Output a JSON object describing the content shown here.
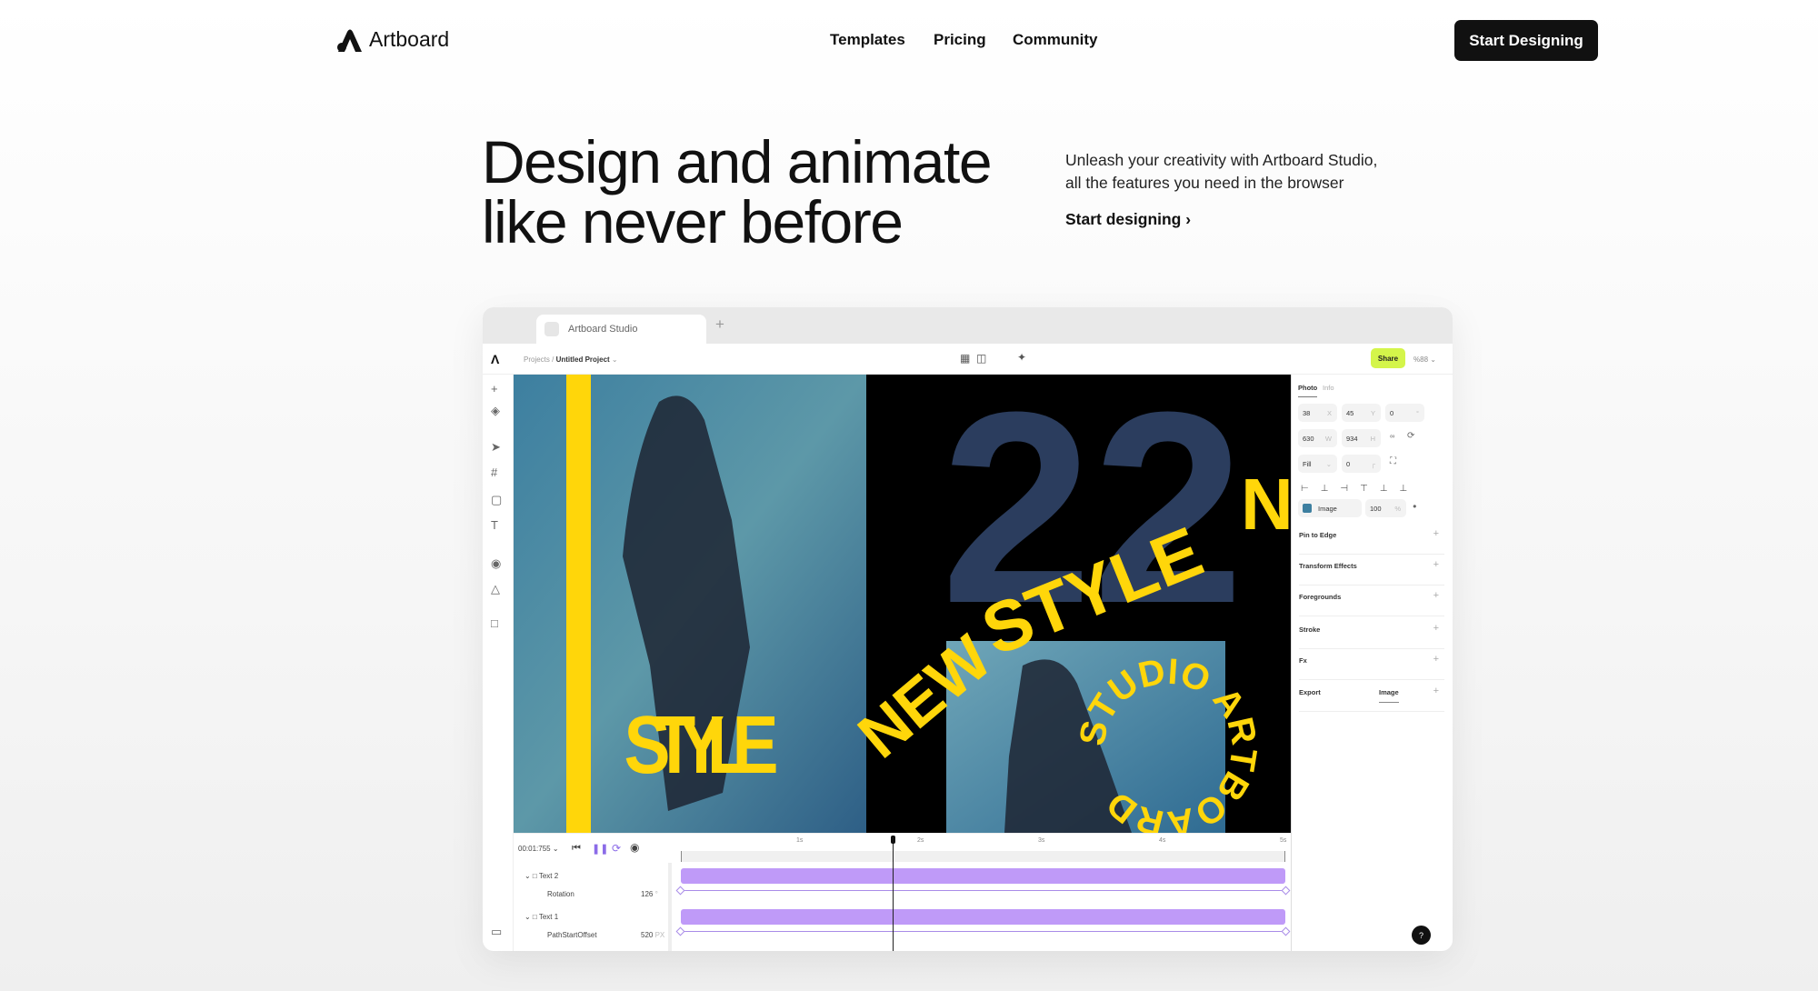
{
  "header": {
    "brand": "Artboard",
    "nav": [
      "Templates",
      "Pricing",
      "Community"
    ],
    "cta": "Start Designing"
  },
  "hero": {
    "title_line1": "Design and animate",
    "title_line2": "like never before",
    "subtitle_line1": "Unleash your creativity with Artboard Studio,",
    "subtitle_line2": "all the features you need in the browser",
    "link": "Start designing"
  },
  "app": {
    "tab": "Artboard Studio",
    "breadcrumb_root": "Projects /",
    "breadcrumb_project": "Untitled Project",
    "share": "Share",
    "zoom": "%88",
    "panel": {
      "tabs": [
        "Photo",
        "Info"
      ],
      "x": "38",
      "y": "45",
      "rot": "0",
      "w": "630",
      "h": "934",
      "fill": "Fill",
      "radius": "0",
      "layer": "Image",
      "opacity": "100",
      "x_l": "X",
      "y_l": "Y",
      "rot_l": "°",
      "w_l": "W",
      "h_l": "H",
      "pct": "%",
      "sections": [
        "Pin to Edge",
        "Transform Effects",
        "Foregrounds",
        "Stroke",
        "Fx",
        "Export"
      ],
      "export_value": "Image"
    },
    "canvas": {
      "text_style": "STYLE",
      "text_new": "NEW",
      "text_style2": "STYLE",
      "text_22": "22",
      "text_n": "N",
      "text_circle": "STUDIO ARTBOARD"
    },
    "accent": "#d4f54a",
    "track_color": "#bf9af8",
    "text_yellow": "#ffd60a",
    "timeline": {
      "time": "00:01:755",
      "ticks": [
        "1s",
        "2s",
        "3s",
        "4s",
        "5s"
      ],
      "playhead_s": 1.755,
      "layers": [
        {
          "name": "Text 2",
          "prop": "Rotation",
          "value": "126",
          "unit": "°"
        },
        {
          "name": "Text 1",
          "prop": "PathStartOffset",
          "value": "520",
          "unit": "PX"
        }
      ]
    }
  }
}
